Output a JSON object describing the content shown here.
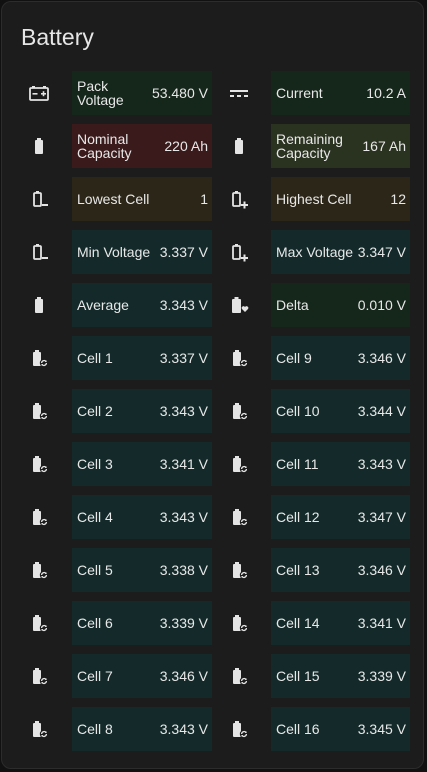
{
  "card": {
    "title": "Battery"
  },
  "rows": [
    [
      {
        "icon": "battery-charging-icon",
        "label": "Pack\nVoltage",
        "value": "53.480 V",
        "bg": "#15261a"
      },
      {
        "icon": "current-dc-icon",
        "label": "Current",
        "value": "10.2 A",
        "bg": "#15261a"
      }
    ],
    [
      {
        "icon": "battery-icon",
        "label": "Nominal\nCapacity",
        "value": "220 Ah",
        "bg": "#3a1a1b"
      },
      {
        "icon": "battery-icon",
        "label": "Remaining\nCapacity",
        "value": "167 Ah",
        "bg": "#2a3220"
      }
    ],
    [
      {
        "icon": "battery-minus-icon",
        "label": "Lowest Cell",
        "value": "1",
        "bg": "#2c2618"
      },
      {
        "icon": "battery-plus-icon",
        "label": "Highest Cell",
        "value": "12",
        "bg": "#2c2618"
      }
    ],
    [
      {
        "icon": "battery-minus-icon",
        "label": "Min Voltage",
        "value": "3.337 V",
        "bg": "#142a2a"
      },
      {
        "icon": "battery-plus-icon",
        "label": "Max Voltage",
        "value": "3.347 V",
        "bg": "#142a2a"
      }
    ],
    [
      {
        "icon": "battery-full-icon",
        "label": "Average",
        "value": "3.343 V",
        "bg": "#142a2a"
      },
      {
        "icon": "battery-heart-icon",
        "label": "Delta",
        "value": "0.010 V",
        "bg": "#15261a"
      }
    ],
    [
      {
        "icon": "battery-sync-icon",
        "label": "Cell 1",
        "value": "3.337 V",
        "bg": "#142a2a"
      },
      {
        "icon": "battery-sync-icon",
        "label": "Cell 9",
        "value": "3.346 V",
        "bg": "#142a2a"
      }
    ],
    [
      {
        "icon": "battery-sync-icon",
        "label": "Cell 2",
        "value": "3.343 V",
        "bg": "#142a2a"
      },
      {
        "icon": "battery-sync-icon",
        "label": "Cell 10",
        "value": "3.344 V",
        "bg": "#142a2a"
      }
    ],
    [
      {
        "icon": "battery-sync-icon",
        "label": "Cell 3",
        "value": "3.341 V",
        "bg": "#142a2a"
      },
      {
        "icon": "battery-sync-icon",
        "label": "Cell 11",
        "value": "3.343 V",
        "bg": "#142a2a"
      }
    ],
    [
      {
        "icon": "battery-sync-icon",
        "label": "Cell 4",
        "value": "3.343 V",
        "bg": "#142a2a"
      },
      {
        "icon": "battery-sync-icon",
        "label": "Cell 12",
        "value": "3.347 V",
        "bg": "#142a2a"
      }
    ],
    [
      {
        "icon": "battery-sync-icon",
        "label": "Cell 5",
        "value": "3.338 V",
        "bg": "#142a2a"
      },
      {
        "icon": "battery-sync-icon",
        "label": "Cell 13",
        "value": "3.346 V",
        "bg": "#142a2a"
      }
    ],
    [
      {
        "icon": "battery-sync-icon",
        "label": "Cell 6",
        "value": "3.339 V",
        "bg": "#142a2a"
      },
      {
        "icon": "battery-sync-icon",
        "label": "Cell 14",
        "value": "3.341 V",
        "bg": "#142a2a"
      }
    ],
    [
      {
        "icon": "battery-sync-icon",
        "label": "Cell 7",
        "value": "3.346 V",
        "bg": "#142a2a"
      },
      {
        "icon": "battery-sync-icon",
        "label": "Cell 15",
        "value": "3.339 V",
        "bg": "#142a2a"
      }
    ],
    [
      {
        "icon": "battery-sync-icon",
        "label": "Cell 8",
        "value": "3.343 V",
        "bg": "#142a2a"
      },
      {
        "icon": "battery-sync-icon",
        "label": "Cell 16",
        "value": "3.345 V",
        "bg": "#142a2a"
      }
    ]
  ]
}
